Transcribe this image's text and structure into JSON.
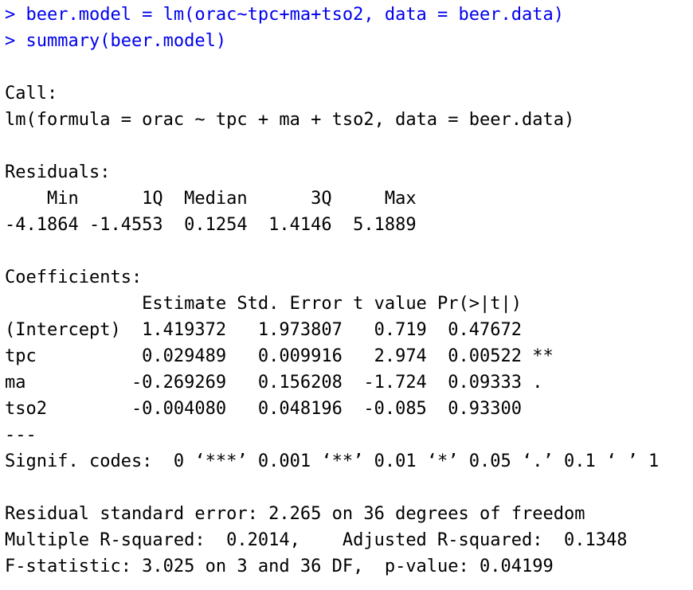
{
  "console": {
    "commands": [
      "> beer.model = lm(orac~tpc+ma+tso2, data = beer.data)",
      "> summary(beer.model)"
    ],
    "call_label": "Call:",
    "call_text": "lm(formula = orac ~ tpc + ma + tso2, data = beer.data)",
    "residuals_label": "Residuals:",
    "residuals_header": "    Min      1Q  Median      3Q     Max",
    "residuals_values": "-4.1864 -1.4553  0.1254  1.4146  5.1889",
    "coefficients_label": "Coefficients:",
    "coefficients_header": "             Estimate Std. Error t value Pr(>|t|)",
    "coefficients_rows": [
      "(Intercept)  1.419372   1.973807   0.719  0.47672",
      "tpc          0.029489   0.009916   2.974  0.00522 **",
      "ma          -0.269269   0.156208  -1.724  0.09333 .",
      "tso2        -0.004080   0.048196  -0.085  0.93300"
    ],
    "separator": "---",
    "signif_codes": "Signif. codes:  0 ‘***’ 0.001 ‘**’ 0.01 ‘*’ 0.05 ‘.’ 0.1 ‘ ’ 1",
    "residual_se": "Residual standard error: 2.265 on 36 degrees of freedom",
    "r_squared": "Multiple R-squared:  0.2014,    Adjusted R-squared:  0.1348",
    "f_statistic": "F-statistic: 3.025 on 3 and 36 DF,  p-value: 0.04199"
  },
  "colors": {
    "command": "#0000ee",
    "output": "#000000",
    "background": "#ffffff"
  }
}
